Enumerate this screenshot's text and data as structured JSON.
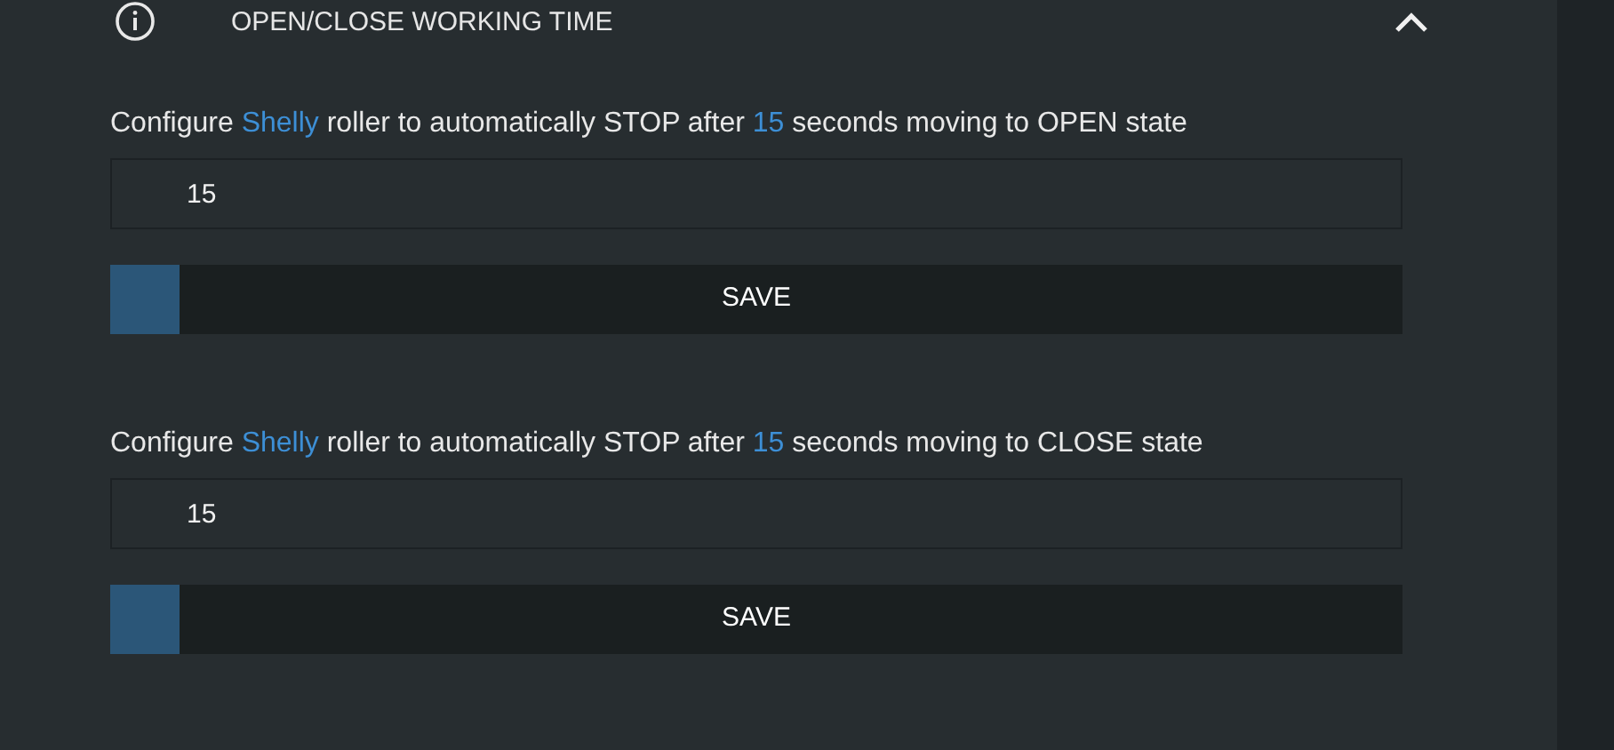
{
  "header": {
    "title": "OPEN/CLOSE WORKING TIME",
    "expanded": true
  },
  "sections": [
    {
      "description": [
        {
          "text": "Configure ",
          "highlight": false
        },
        {
          "text": "Shelly",
          "highlight": true
        },
        {
          "text": " roller to automatically STOP after ",
          "highlight": false
        },
        {
          "text": "15",
          "highlight": true
        },
        {
          "text": " seconds moving to OPEN state",
          "highlight": false
        }
      ],
      "value": "15",
      "button": "SAVE"
    },
    {
      "description": [
        {
          "text": "Configure ",
          "highlight": false
        },
        {
          "text": "Shelly",
          "highlight": true
        },
        {
          "text": " roller to automatically STOP after ",
          "highlight": false
        },
        {
          "text": "15",
          "highlight": true
        },
        {
          "text": " seconds moving to CLOSE state",
          "highlight": false
        }
      ],
      "value": "15",
      "button": "SAVE"
    }
  ]
}
